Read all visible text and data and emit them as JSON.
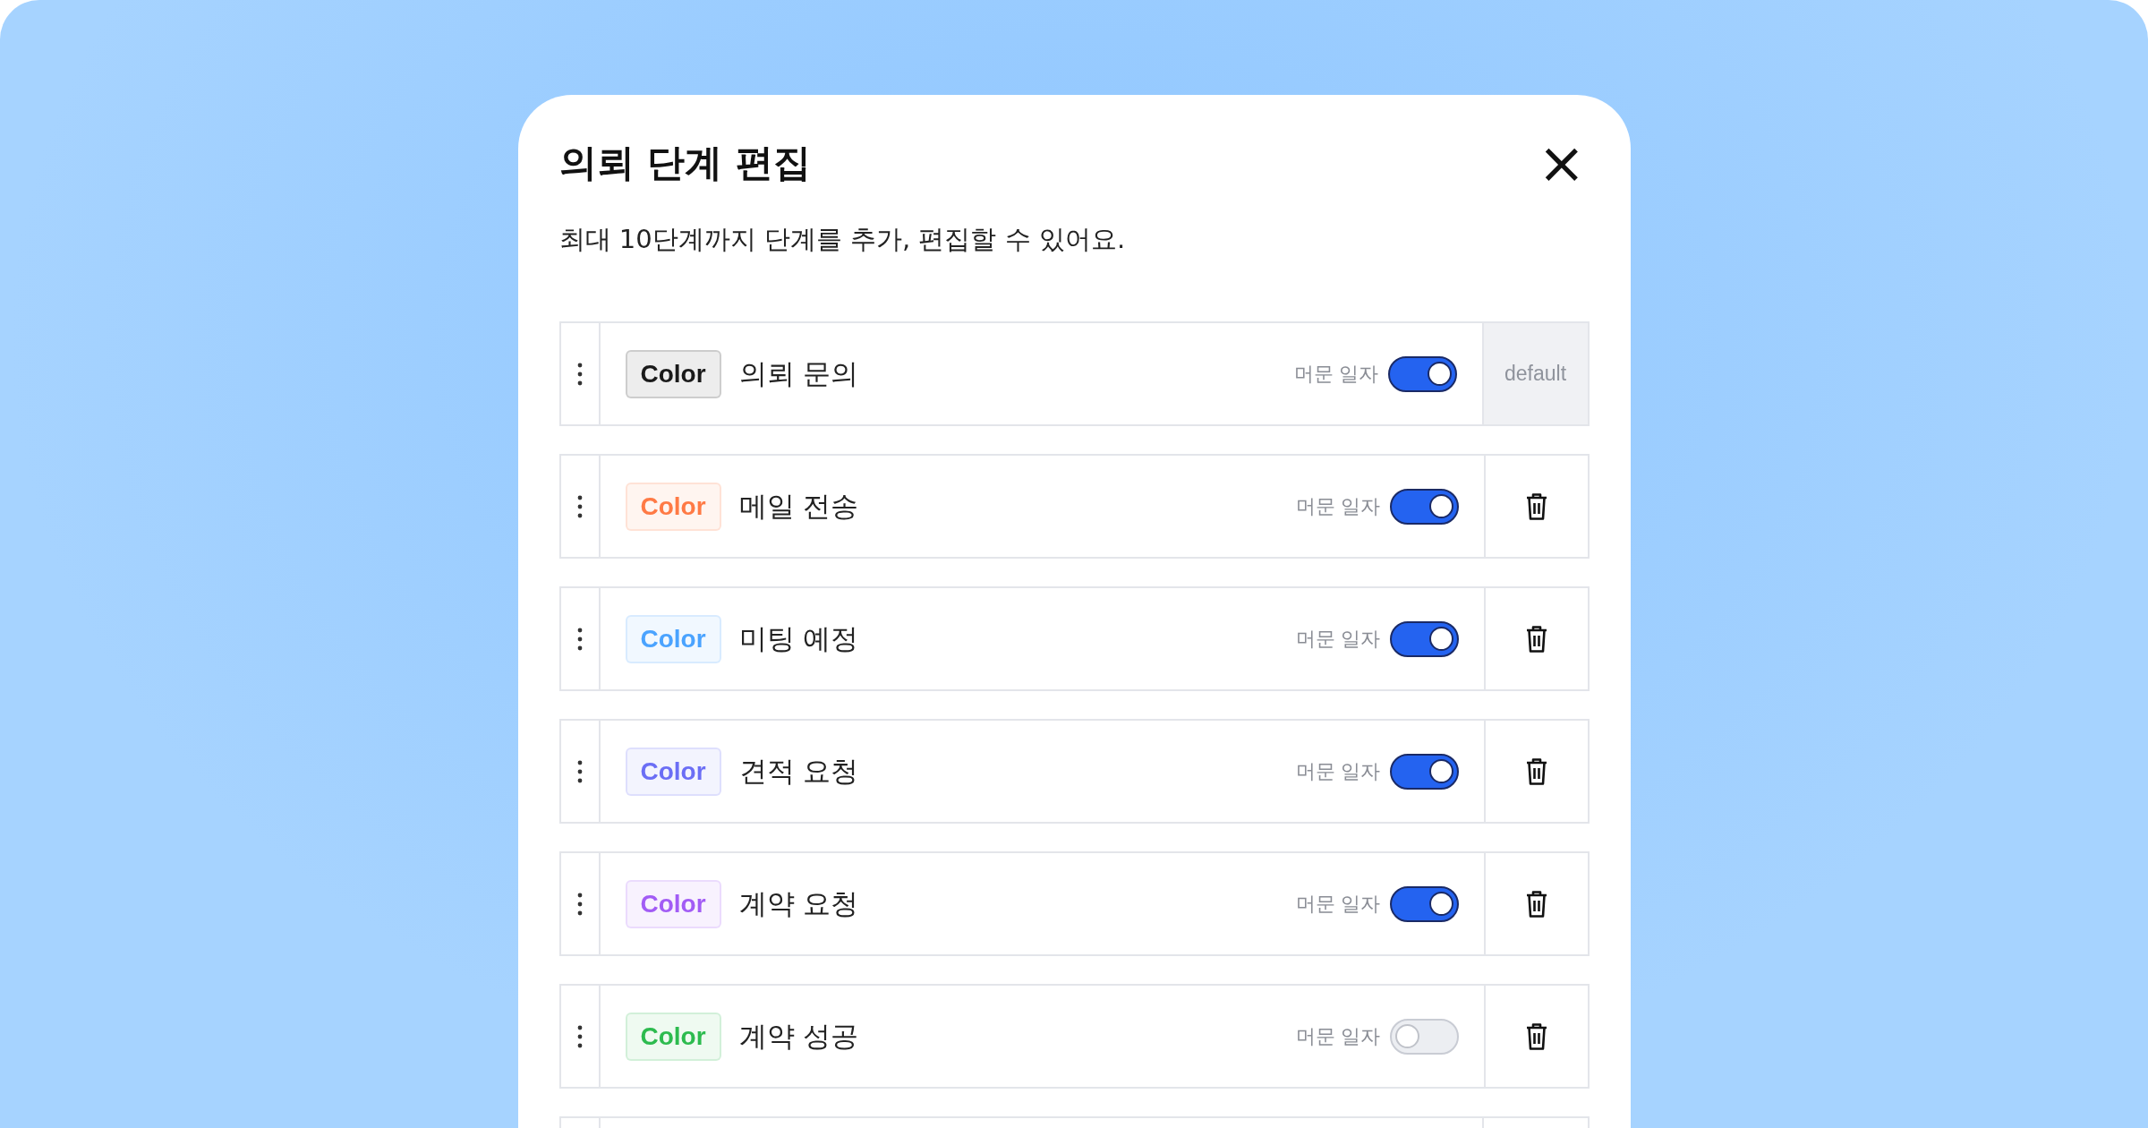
{
  "dialog": {
    "title": "의뢰 단계 편집",
    "description": "최대 10단계까지 단계를 추가, 편집할 수 있어요.",
    "close_label": "×"
  },
  "stages": [
    {
      "chip": "Color",
      "color": "#1a1a1a",
      "name": "의뢰 문의",
      "toggle_label": "머문 일자",
      "on": true,
      "action": {
        "kind": "default",
        "label": "default"
      }
    },
    {
      "chip": "Color",
      "color": "#ff7a45",
      "name": "메일 전송",
      "toggle_label": "머문 일자",
      "on": true,
      "action": {
        "kind": "delete"
      }
    },
    {
      "chip": "Color",
      "color": "#4aa3ff",
      "name": "미팅 예정",
      "toggle_label": "머문 일자",
      "on": true,
      "action": {
        "kind": "delete"
      }
    },
    {
      "chip": "Color",
      "color": "#6b6ef5",
      "name": "견적 요청",
      "toggle_label": "머문 일자",
      "on": true,
      "action": {
        "kind": "delete"
      }
    },
    {
      "chip": "Color",
      "color": "#a25cf5",
      "name": "계약 요청",
      "toggle_label": "머문 일자",
      "on": true,
      "action": {
        "kind": "delete"
      }
    },
    {
      "chip": "Color",
      "color": "#2dbb4f",
      "name": "계약 성공",
      "toggle_label": "머문 일자",
      "on": false,
      "action": {
        "kind": "delete"
      }
    }
  ],
  "more_below": true
}
